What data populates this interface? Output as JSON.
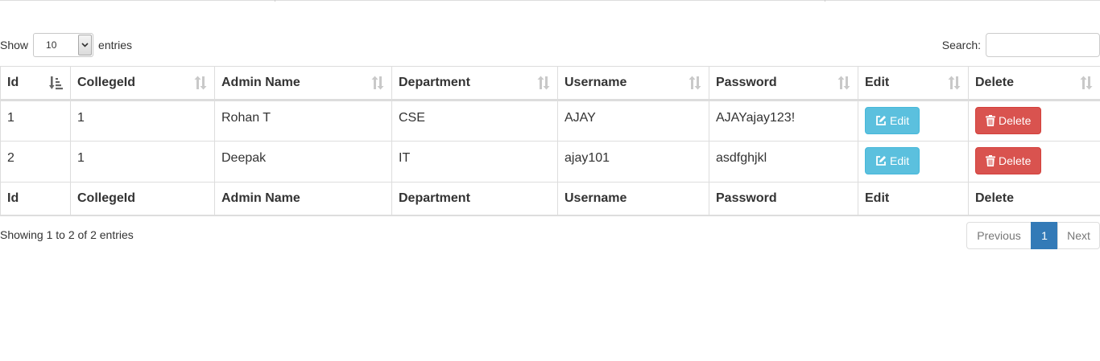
{
  "length_control": {
    "prefix": "Show",
    "selected": "10",
    "suffix": "entries"
  },
  "search": {
    "label": "Search:",
    "value": ""
  },
  "table": {
    "columns": [
      "Id",
      "CollegeId",
      "Admin Name",
      "Department",
      "Username",
      "Password",
      "Edit",
      "Delete"
    ],
    "sorted_column": "Id",
    "rows": [
      {
        "id": "1",
        "college_id": "1",
        "admin_name": "Rohan T",
        "department": "CSE",
        "username": "AJAY",
        "password": "AJAYajay123!",
        "edit_label": "Edit",
        "delete_label": "Delete"
      },
      {
        "id": "2",
        "college_id": "1",
        "admin_name": "Deepak",
        "department": "IT",
        "username": "ajay101",
        "password": "asdfghjkl",
        "edit_label": "Edit",
        "delete_label": "Delete"
      }
    ],
    "footer": [
      "Id",
      "CollegeId",
      "Admin Name",
      "Department",
      "Username",
      "Password",
      "Edit",
      "Delete"
    ]
  },
  "info": "Showing 1 to 2 of 2 entries",
  "pagination": {
    "previous": "Previous",
    "current_page": "1",
    "next": "Next"
  },
  "colors": {
    "edit_button": "#5bc0de",
    "delete_button": "#d9534f",
    "active_page": "#337ab7"
  },
  "icons": {
    "sort_active": "sort-ascending-icon",
    "sort_inactive": "sort-both-icon",
    "edit": "pencil-square-icon",
    "delete": "trash-icon"
  }
}
